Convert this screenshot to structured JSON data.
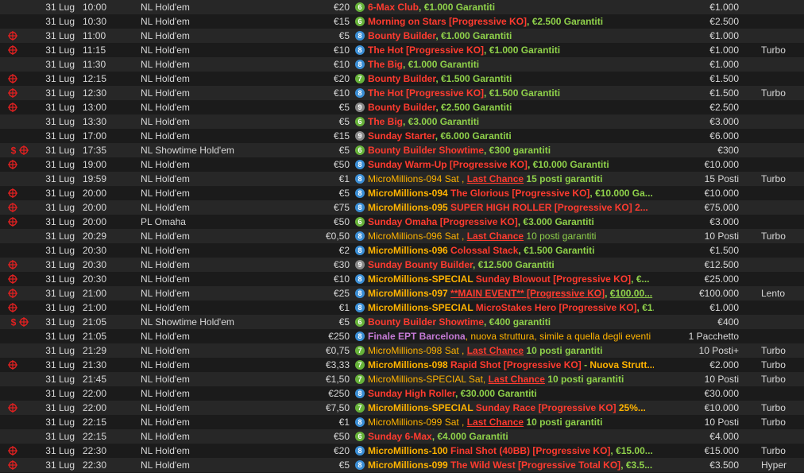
{
  "colors": {
    "badge_green": "#67b33a",
    "badge_blue": "#3b8fd6",
    "badge_grey": "#8a8a8a",
    "icon_red": "#e02020"
  },
  "rows": [
    {
      "date": "31 Lug",
      "time": "10:00",
      "game": "NL Hold'em",
      "buyin": "€20",
      "badge": "6",
      "badge_color": "green",
      "icons": [],
      "segs": [
        {
          "t": "6-Max Club",
          "c": "r"
        },
        {
          "t": ", ",
          "c": "g"
        },
        {
          "t": "€1.000 Garantiti",
          "c": "g"
        }
      ],
      "prize": "€1.000",
      "speed": ""
    },
    {
      "date": "31 Lug",
      "time": "10:30",
      "game": "NL Hold'em",
      "buyin": "€15",
      "badge": "6",
      "badge_color": "green",
      "icons": [],
      "segs": [
        {
          "t": "Morning on Stars [Progressive KO]",
          "c": "r"
        },
        {
          "t": ", €2.500 Garantiti",
          "c": "g"
        }
      ],
      "prize": "€2.500",
      "speed": ""
    },
    {
      "date": "31 Lug",
      "time": "11:00",
      "game": "NL Hold'em",
      "buyin": "€5",
      "badge": "8",
      "badge_color": "blue",
      "icons": [
        "target"
      ],
      "segs": [
        {
          "t": "Bounty Builder",
          "c": "r"
        },
        {
          "t": ", €1.000 Garantiti",
          "c": "g"
        }
      ],
      "prize": "€1.000",
      "speed": ""
    },
    {
      "date": "31 Lug",
      "time": "11:15",
      "game": "NL Hold'em",
      "buyin": "€10",
      "badge": "8",
      "badge_color": "blue",
      "icons": [
        "target"
      ],
      "segs": [
        {
          "t": "The Hot [Progressive KO]",
          "c": "r"
        },
        {
          "t": ", €1.000 Garantiti",
          "c": "g"
        }
      ],
      "prize": "€1.000",
      "speed": "Turbo"
    },
    {
      "date": "31 Lug",
      "time": "11:30",
      "game": "NL Hold'em",
      "buyin": "€10",
      "badge": "8",
      "badge_color": "blue",
      "icons": [],
      "segs": [
        {
          "t": "The Big",
          "c": "r"
        },
        {
          "t": ", €1.000 Garantiti",
          "c": "g"
        }
      ],
      "prize": "€1.000",
      "speed": ""
    },
    {
      "date": "31 Lug",
      "time": "12:15",
      "game": "NL Hold'em",
      "buyin": "€20",
      "badge": "7",
      "badge_color": "green",
      "icons": [
        "target"
      ],
      "segs": [
        {
          "t": "Bounty Builder",
          "c": "r"
        },
        {
          "t": ", €1.500 Garantiti",
          "c": "g"
        }
      ],
      "prize": "€1.500",
      "speed": ""
    },
    {
      "date": "31 Lug",
      "time": "12:30",
      "game": "NL Hold'em",
      "buyin": "€10",
      "badge": "8",
      "badge_color": "blue",
      "icons": [
        "target"
      ],
      "segs": [
        {
          "t": "The Hot [Progressive KO]",
          "c": "r"
        },
        {
          "t": ", €1.500 Garantiti",
          "c": "g"
        }
      ],
      "prize": "€1.500",
      "speed": "Turbo"
    },
    {
      "date": "31 Lug",
      "time": "13:00",
      "game": "NL Hold'em",
      "buyin": "€5",
      "badge": "9",
      "badge_color": "grey",
      "icons": [
        "target"
      ],
      "segs": [
        {
          "t": "Bounty Builder",
          "c": "r"
        },
        {
          "t": ", €2.500 Garantiti",
          "c": "g"
        }
      ],
      "prize": "€2.500",
      "speed": ""
    },
    {
      "date": "31 Lug",
      "time": "13:30",
      "game": "NL Hold'em",
      "buyin": "€5",
      "badge": "6",
      "badge_color": "green",
      "icons": [],
      "segs": [
        {
          "t": "The Big",
          "c": "r"
        },
        {
          "t": ", €3.000 Garantiti",
          "c": "g"
        }
      ],
      "prize": "€3.000",
      "speed": ""
    },
    {
      "date": "31 Lug",
      "time": "17:00",
      "game": "NL Hold'em",
      "buyin": "€15",
      "badge": "9",
      "badge_color": "grey",
      "icons": [],
      "segs": [
        {
          "t": "Sunday Starter",
          "c": "r"
        },
        {
          "t": ", €6.000 Garantiti",
          "c": "g"
        }
      ],
      "prize": "€6.000",
      "speed": ""
    },
    {
      "date": "31 Lug",
      "time": "17:35",
      "game": "NL Showtime Hold'em",
      "buyin": "€5",
      "badge": "6",
      "badge_color": "green",
      "icons": [
        "dollar",
        "target"
      ],
      "segs": [
        {
          "t": "Bounty Builder Showtime",
          "c": "r"
        },
        {
          "t": ", €300 garantiti",
          "c": "g"
        }
      ],
      "prize": "€300",
      "speed": ""
    },
    {
      "date": "31 Lug",
      "time": "19:00",
      "game": "NL Hold'em",
      "buyin": "€50",
      "badge": "8",
      "badge_color": "blue",
      "icons": [
        "target"
      ],
      "segs": [
        {
          "t": "Sunday Warm-Up [Progressive KO]",
          "c": "r"
        },
        {
          "t": ", €10.000 Garantiti",
          "c": "g"
        }
      ],
      "prize": "€10.000",
      "speed": ""
    },
    {
      "date": "31 Lug",
      "time": "19:59",
      "game": "NL Hold'em",
      "buyin": "€1",
      "badge": "8",
      "badge_color": "blue",
      "icons": [],
      "segs": [
        {
          "t": "MicroMillions-094 Sat , ",
          "c": "ow"
        },
        {
          "t": "Last Chance",
          "c": "ru"
        },
        {
          "t": " 15 posti garantiti",
          "c": "g"
        }
      ],
      "prize": "15 Posti",
      "speed": "Turbo"
    },
    {
      "date": "31 Lug",
      "time": "20:00",
      "game": "NL Hold'em",
      "buyin": "€5",
      "badge": "8",
      "badge_color": "blue",
      "icons": [
        "target"
      ],
      "segs": [
        {
          "t": "MicroMillions-094 ",
          "c": "o"
        },
        {
          "t": "The Glorious [Progressive KO]",
          "c": "r"
        },
        {
          "t": ", €10.000 Ga...",
          "c": "g"
        }
      ],
      "prize": "€10.000",
      "speed": ""
    },
    {
      "date": "31 Lug",
      "time": "20:00",
      "game": "NL Hold'em",
      "buyin": "€75",
      "badge": "8",
      "badge_color": "blue",
      "icons": [
        "target"
      ],
      "segs": [
        {
          "t": "MicroMillions-095 ",
          "c": "o"
        },
        {
          "t": "SUPER HIGH ROLLER [Progressive KO]  2...",
          "c": "r"
        }
      ],
      "prize": "€75.000",
      "speed": ""
    },
    {
      "date": "31 Lug",
      "time": "20:00",
      "game": "PL Omaha",
      "buyin": "€50",
      "badge": "6",
      "badge_color": "green",
      "icons": [
        "target"
      ],
      "segs": [
        {
          "t": "Sunday Omaha [Progressive KO]",
          "c": "r"
        },
        {
          "t": ", €3.000 Garantiti",
          "c": "g"
        }
      ],
      "prize": "€3.000",
      "speed": ""
    },
    {
      "date": "31 Lug",
      "time": "20:29",
      "game": "NL Hold'em",
      "buyin": "€0,50",
      "badge": "8",
      "badge_color": "blue",
      "icons": [],
      "segs": [
        {
          "t": "MicroMillions-096 Sat , ",
          "c": "ow"
        },
        {
          "t": "Last Chance",
          "c": "ru"
        },
        {
          "t": " 10 posti garantiti",
          "c": "gw"
        }
      ],
      "prize": "10 Posti",
      "speed": "Turbo"
    },
    {
      "date": "31 Lug",
      "time": "20:30",
      "game": "NL Hold'em",
      "buyin": "€2",
      "badge": "8",
      "badge_color": "blue",
      "icons": [],
      "segs": [
        {
          "t": "MicroMillions-096 ",
          "c": "o"
        },
        {
          "t": "Colossal Stack",
          "c": "r"
        },
        {
          "t": ", €1.500 Garantiti",
          "c": "g"
        }
      ],
      "prize": "€1.500",
      "speed": ""
    },
    {
      "date": "31 Lug",
      "time": "20:30",
      "game": "NL Hold'em",
      "buyin": "€30",
      "badge": "9",
      "badge_color": "grey",
      "icons": [
        "target"
      ],
      "segs": [
        {
          "t": "Sunday Bounty Builder",
          "c": "r"
        },
        {
          "t": ", €12.500 Garantiti",
          "c": "g"
        }
      ],
      "prize": "€12.500",
      "speed": ""
    },
    {
      "date": "31 Lug",
      "time": "20:30",
      "game": "NL Hold'em",
      "buyin": "€10",
      "badge": "8",
      "badge_color": "blue",
      "icons": [
        "target"
      ],
      "segs": [
        {
          "t": "MicroMillions-SPECIAL ",
          "c": "o"
        },
        {
          "t": "Sunday Blowout [Progressive KO]",
          "c": "r"
        },
        {
          "t": ", €...",
          "c": "g"
        }
      ],
      "prize": "€25.000",
      "speed": ""
    },
    {
      "date": "31 Lug",
      "time": "21:00",
      "game": "NL Hold'em",
      "buyin": "€25",
      "badge": "8",
      "badge_color": "blue",
      "icons": [
        "target"
      ],
      "segs": [
        {
          "t": "MicroMillions-097 ",
          "c": "o"
        },
        {
          "t": " **MAIN EVENT** [Progressive KO]",
          "c": "ru"
        },
        {
          "t": ", ",
          "c": "g"
        },
        {
          "t": "€100.00...",
          "c": "gu"
        }
      ],
      "prize": "€100.000",
      "speed": "Lento"
    },
    {
      "date": "31 Lug",
      "time": "21:00",
      "game": "NL Hold'em",
      "buyin": "€1",
      "badge": "8",
      "badge_color": "blue",
      "icons": [
        "target"
      ],
      "segs": [
        {
          "t": "MicroMillions-SPECIAL ",
          "c": "o"
        },
        {
          "t": "MicroStakes Hero [Progressive KO]",
          "c": "r"
        },
        {
          "t": ", €1.0...",
          "c": "g"
        }
      ],
      "prize": "€1.000",
      "speed": ""
    },
    {
      "date": "31 Lug",
      "time": "21:05",
      "game": "NL Showtime Hold'em",
      "buyin": "€5",
      "badge": "6",
      "badge_color": "green",
      "icons": [
        "dollar",
        "target"
      ],
      "segs": [
        {
          "t": "Bounty Builder Showtime",
          "c": "r"
        },
        {
          "t": ", €400 garantiti",
          "c": "g"
        }
      ],
      "prize": "€400",
      "speed": ""
    },
    {
      "date": "31 Lug",
      "time": "21:05",
      "game": "NL Hold'em",
      "buyin": "€250",
      "badge": "8",
      "badge_color": "blue",
      "icons": [],
      "segs": [
        {
          "t": "Finale EPT Barcelona",
          "c": "p"
        },
        {
          "t": ", nuova struttura, simile a quella degli eventi li...",
          "c": "ow"
        }
      ],
      "prize": "1 Pacchetto",
      "speed": ""
    },
    {
      "date": "31 Lug",
      "time": "21:29",
      "game": "NL Hold'em",
      "buyin": "€0,75",
      "badge": "7",
      "badge_color": "green",
      "icons": [],
      "segs": [
        {
          "t": "MicroMillions-098 Sat , ",
          "c": "ow"
        },
        {
          "t": "Last Chance",
          "c": "ru"
        },
        {
          "t": " 10 posti garantiti",
          "c": "g"
        }
      ],
      "prize": "10 Posti+",
      "speed": "Turbo"
    },
    {
      "date": "31 Lug",
      "time": "21:30",
      "game": "NL Hold'em",
      "buyin": "€3,33",
      "badge": "7",
      "badge_color": "green",
      "icons": [
        "target"
      ],
      "segs": [
        {
          "t": "MicroMillions-098 ",
          "c": "o"
        },
        {
          "t": "Rapid Shot [Progressive KO]",
          "c": "r"
        },
        {
          "t": " - ",
          "c": "g"
        },
        {
          "t": "Nuova Strutt...",
          "c": "o"
        }
      ],
      "prize": "€2.000",
      "speed": "Turbo"
    },
    {
      "date": "31 Lug",
      "time": "21:45",
      "game": "NL Hold'em",
      "buyin": "€1,50",
      "badge": "7",
      "badge_color": "green",
      "icons": [],
      "segs": [
        {
          "t": "MicroMillions-SPECIAL Sat, ",
          "c": "ow"
        },
        {
          "t": "Last Chance",
          "c": "ru"
        },
        {
          "t": " 10 posti garantiti",
          "c": "g"
        }
      ],
      "prize": "10 Posti",
      "speed": "Turbo"
    },
    {
      "date": "31 Lug",
      "time": "22:00",
      "game": "NL Hold'em",
      "buyin": "€250",
      "badge": "8",
      "badge_color": "blue",
      "icons": [],
      "segs": [
        {
          "t": "Sunday High Roller",
          "c": "r"
        },
        {
          "t": ", €30.000 Garantiti",
          "c": "g"
        }
      ],
      "prize": "€30.000",
      "speed": ""
    },
    {
      "date": "31 Lug",
      "time": "22:00",
      "game": "NL Hold'em",
      "buyin": "€7,50",
      "badge": "7",
      "badge_color": "green",
      "icons": [
        "target"
      ],
      "segs": [
        {
          "t": "MicroMillions-SPECIAL ",
          "c": "o"
        },
        {
          "t": "Sunday Race [Progressive KO]",
          "c": "r"
        },
        {
          "t": "  25%...",
          "c": "o"
        }
      ],
      "prize": "€10.000",
      "speed": "Turbo"
    },
    {
      "date": "31 Lug",
      "time": "22:15",
      "game": "NL Hold'em",
      "buyin": "€1",
      "badge": "8",
      "badge_color": "blue",
      "icons": [],
      "segs": [
        {
          "t": "MicroMillions-099 Sat , ",
          "c": "ow"
        },
        {
          "t": "Last Chance",
          "c": "ru"
        },
        {
          "t": " 10 posti garantiti",
          "c": "g"
        }
      ],
      "prize": "10 Posti",
      "speed": "Turbo"
    },
    {
      "date": "31 Lug",
      "time": "22:15",
      "game": "NL Hold'em",
      "buyin": "€50",
      "badge": "6",
      "badge_color": "green",
      "icons": [],
      "segs": [
        {
          "t": "Sunday 6-Max",
          "c": "r"
        },
        {
          "t": ", €4.000 Garantiti",
          "c": "g"
        }
      ],
      "prize": "€4.000",
      "speed": ""
    },
    {
      "date": "31 Lug",
      "time": "22:30",
      "game": "NL Hold'em",
      "buyin": "€20",
      "badge": "8",
      "badge_color": "blue",
      "icons": [
        "target"
      ],
      "segs": [
        {
          "t": "MicroMillions-100 ",
          "c": "o"
        },
        {
          "t": "Final Shot (40BB) [Progressive KO]",
          "c": "r"
        },
        {
          "t": ", €15.00...",
          "c": "g"
        }
      ],
      "prize": "€15.000",
      "speed": "Turbo"
    },
    {
      "date": "31 Lug",
      "time": "22:30",
      "game": "NL Hold'em",
      "buyin": "€5",
      "badge": "8",
      "badge_color": "blue",
      "icons": [
        "target"
      ],
      "segs": [
        {
          "t": "MicroMillions-099 ",
          "c": "o"
        },
        {
          "t": "The Wild West [Progressive Total KO]",
          "c": "r"
        },
        {
          "t": ", €3.5...",
          "c": "g"
        }
      ],
      "prize": "€3.500",
      "speed": "Hyper"
    }
  ]
}
